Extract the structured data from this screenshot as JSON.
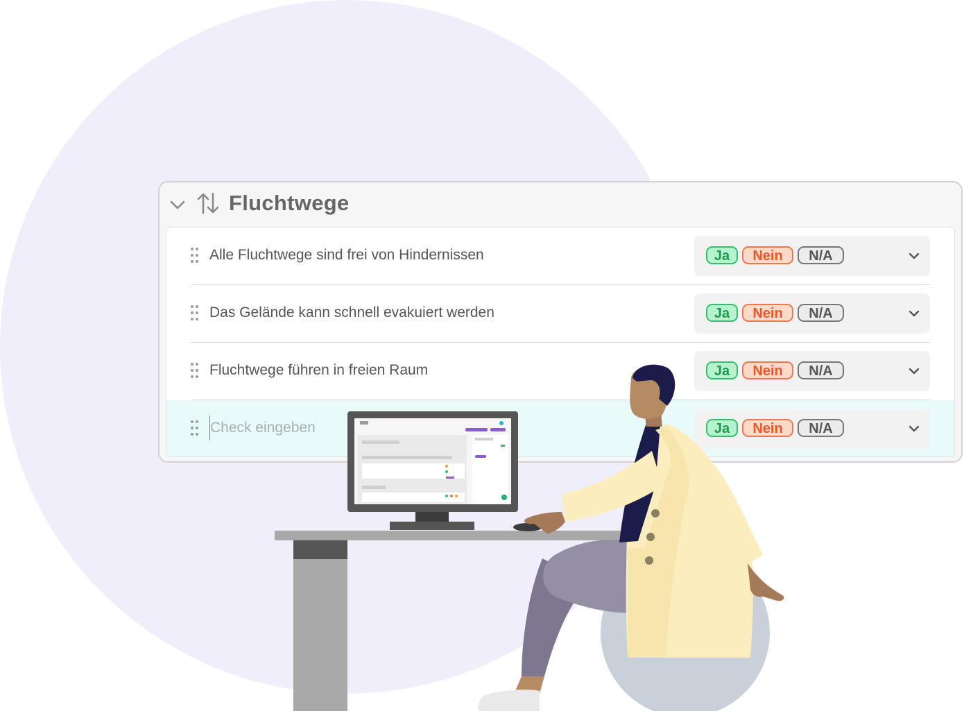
{
  "section": {
    "title": "Fluchtwege",
    "collapse_icon": "chevron-down-icon",
    "sort_icon": "sort-arrows-icon"
  },
  "checks": [
    {
      "text": "Alle Fluchtwege sind frei von Hindernissen"
    },
    {
      "text": "Das Gelände kann schnell evakuiert werden"
    },
    {
      "text": "Fluchtwege führen in freien Raum"
    }
  ],
  "new_check": {
    "placeholder": "Check eingeben",
    "value": ""
  },
  "answers": {
    "yes": "Ja",
    "no": "Nein",
    "na": "N/A"
  },
  "colors": {
    "yes": "#35bf6a",
    "no": "#f0774a",
    "na": "#777777",
    "active_row": "#e8fbfa",
    "background_circle": "#f1eefb"
  }
}
